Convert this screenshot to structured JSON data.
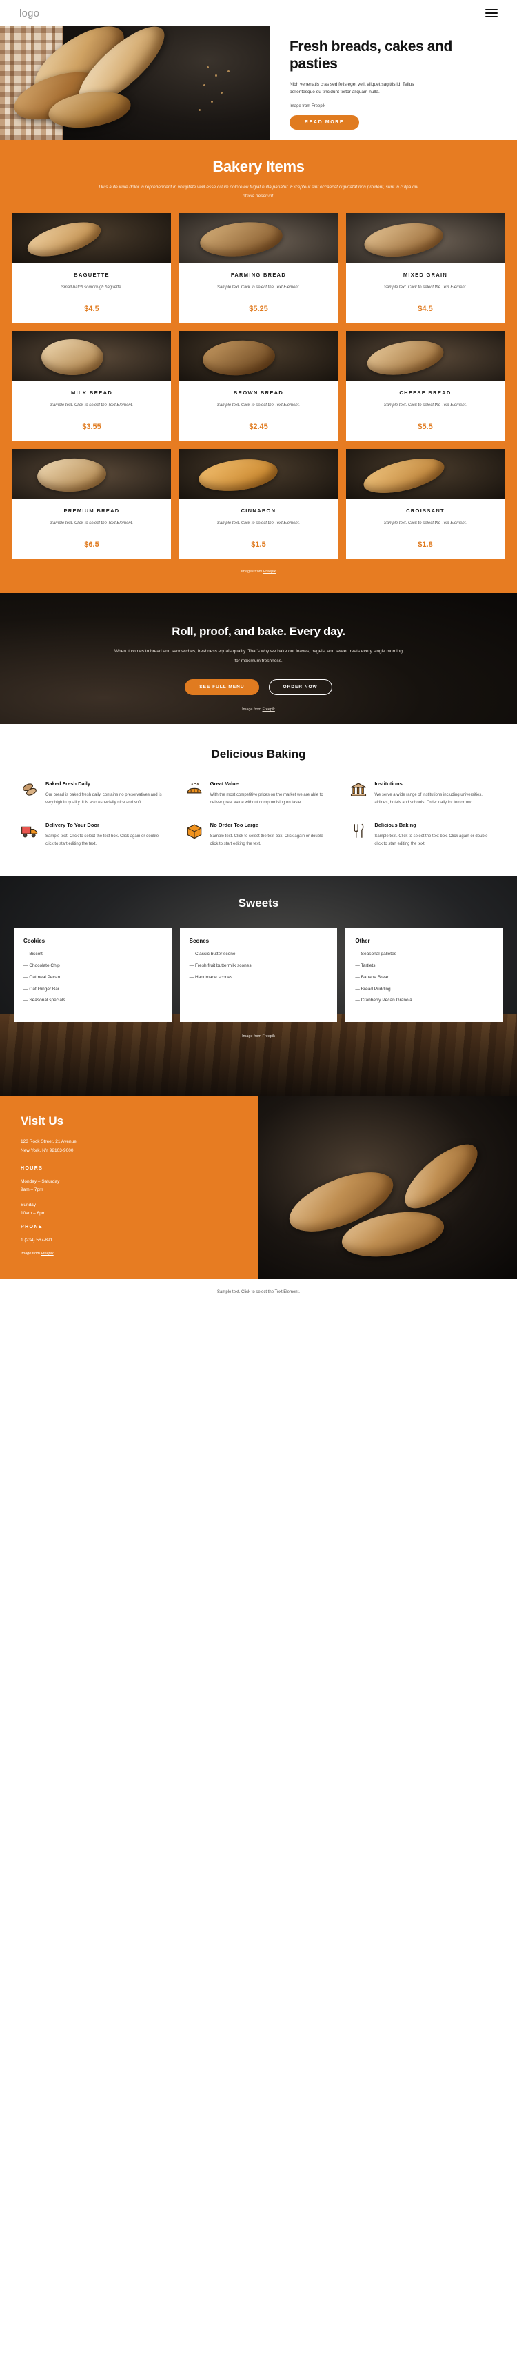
{
  "header": {
    "logo": "logo",
    "menu_icon": "hamburger-icon"
  },
  "hero": {
    "title": "Fresh breads, cakes and pasties",
    "body": "Nibh venenatis cras sed felis eget velit aliquet sagittis id. Tellus pellentesque eu tincidunt tortor aliquam nulla.",
    "credit_prefix": "Image from ",
    "credit_link": "Freepik",
    "button": "READ MORE"
  },
  "items": {
    "title": "Bakery Items",
    "subtitle": "Duis aute irure dolor in reprehenderit in voluptate velit esse cillum dolore eu fugiat nulla pariatur. Excepteur sint occaecat cupidatat non proident, sunt in culpa qui officia deserunt.",
    "credit_prefix": "Images from ",
    "credit_link": "Freepik",
    "cards": [
      {
        "name": "BAGUETTE",
        "desc": "Small-batch sourdough baguette.",
        "price": "$4.5"
      },
      {
        "name": "FARMING BREAD",
        "desc": "Sample text. Click to select the Text Element.",
        "price": "$5.25"
      },
      {
        "name": "MIXED GRAIN",
        "desc": "Sample text. Click to select the Text Element.",
        "price": "$4.5"
      },
      {
        "name": "MILK BREAD",
        "desc": "Sample text. Click to select the Text Element.",
        "price": "$3.55"
      },
      {
        "name": "BROWN BREAD",
        "desc": "Sample text. Click to select the Text Element.",
        "price": "$2.45"
      },
      {
        "name": "CHEESE BREAD",
        "desc": "Sample text. Click to select the Text Element.",
        "price": "$5.5"
      },
      {
        "name": "PREMIUM BREAD",
        "desc": "Sample text. Click to select the Text Element.",
        "price": "$6.5"
      },
      {
        "name": "CINNABON",
        "desc": "Sample text. Click to select the Text Element.",
        "price": "$1.5"
      },
      {
        "name": "CROISSANT",
        "desc": "Sample text. Click to select the Text Element.",
        "price": "$1.8"
      }
    ]
  },
  "cta": {
    "title": "Roll, proof, and bake. Every day.",
    "body": "When it comes to bread and sandwiches, freshness equals quality. That's why we bake our loaves, bagels, and sweet treats every single morning for maximum freshness.",
    "button_primary": "SEE FULL MENU",
    "button_secondary": "ORDER NOW",
    "credit_prefix": "Image from ",
    "credit_link": "Freepik"
  },
  "features": {
    "title": "Delicious Baking",
    "list": [
      {
        "icon": "bread-loaves-icon",
        "heading": "Baked Fresh Daily",
        "text": "Our bread is baked fresh daily, contains no preservatives and is very high in quality. It is also especially nice and soft"
      },
      {
        "icon": "hot-bread-icon",
        "heading": "Great Value",
        "text": "With the most competitive prices on the market we are able to deliver great value without compromising on taste"
      },
      {
        "icon": "institution-icon",
        "heading": "Institutions",
        "text": "We serve a wide range of institutions including universities, airlines, hotels and schools. Order daily for tomorrow"
      },
      {
        "icon": "delivery-truck-icon",
        "heading": "Delivery To Your Door",
        "text": "Sample text. Click to select the text box. Click again or double click to start editing the text."
      },
      {
        "icon": "package-box-icon",
        "heading": "No Order Too Large",
        "text": "Sample text. Click to select the text box. Click again or double click to start editing the text."
      },
      {
        "icon": "cutlery-icon",
        "heading": "Delicious Baking",
        "text": "Sample text. Click to select the text box. Click again or double click to start editing the text."
      }
    ]
  },
  "sweets": {
    "title": "Sweets",
    "credit_prefix": "Image from ",
    "credit_link": "Freepik",
    "columns": [
      {
        "heading": "Cookies",
        "items": [
          "Biscotti",
          "Chocolate Chip",
          "Oatmeal Pecan",
          "Oat Ginger Bar",
          "Seasonal specials"
        ]
      },
      {
        "heading": "Scones",
        "items": [
          "Classic butter scone",
          "Fresh fruit buttermilk scones",
          "Handmade scones"
        ]
      },
      {
        "heading": "Other",
        "items": [
          "Seasonal galletes",
          "Tartlets",
          "Banana Bread",
          "Bread Pudding",
          "Cranberry Pecan Granola"
        ]
      }
    ]
  },
  "visit": {
    "title": "Visit Us",
    "address_line1": "123 Rock Street, 21 Avenue",
    "address_line2": "New York, NY 92103-9000",
    "hours_label": "HOURS",
    "hours": [
      {
        "days": "Monday – Saturday",
        "time": "9am – 7pm"
      },
      {
        "days": "Sunday",
        "time": "10am – 6pm"
      }
    ],
    "phone_label": "PHONE",
    "phone": "1 (234) 567-891",
    "credit_prefix": "Image from ",
    "credit_link": "Freepik"
  },
  "bottom": {
    "text": "Sample text. Click to select the Text Element."
  },
  "colors": {
    "accent": "#e77c22",
    "accent_dark": "#e07b20",
    "dark": "#100d0b",
    "white": "#ffffff"
  }
}
